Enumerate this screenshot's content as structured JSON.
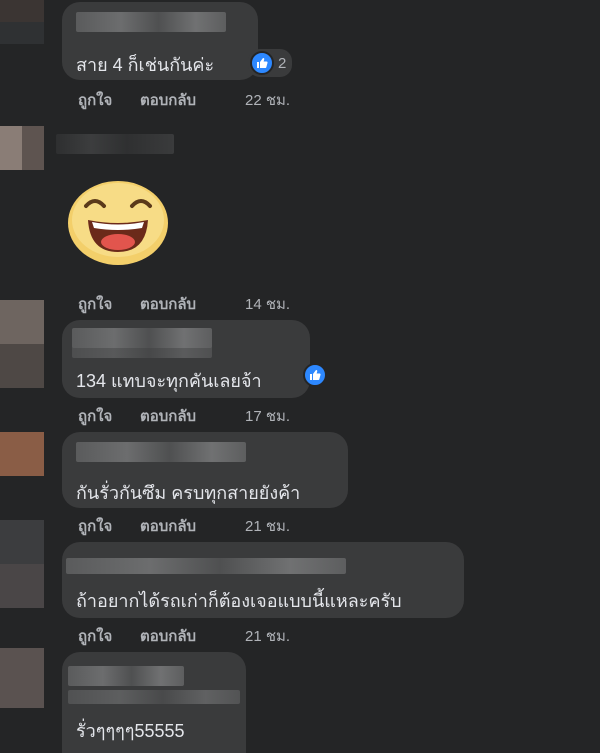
{
  "comments": [
    {
      "text": "สาย 4 ก็เช่นกันค่ะ",
      "reaction_count": "2",
      "like": "ถูกใจ",
      "reply": "ตอบกลับ",
      "time": "22 ชม."
    },
    {
      "text": "",
      "like": "ถูกใจ",
      "reply": "ตอบกลับ",
      "time": "14 ชม."
    },
    {
      "text": "134 แทบจะทุกคันเลยจ้า",
      "like": "ถูกใจ",
      "reply": "ตอบกลับ",
      "time": "17 ชม."
    },
    {
      "text": "กันรั่วกันซึม ครบทุกสายยังค้า",
      "like": "ถูกใจ",
      "reply": "ตอบกลับ",
      "time": "21 ชม."
    },
    {
      "text": "ถ้าอยากได้รถเก่าก็ต้องเจอแบบนี้แหละครับ",
      "like": "ถูกใจ",
      "reply": "ตอบกลับ",
      "time": "21 ชม."
    },
    {
      "text": "รั่วๆๆๆๆ55555"
    }
  ],
  "colors": {
    "background": "#242526",
    "bubble": "#3a3b3c",
    "like_blue": "#2d88ff",
    "emoji_yellow": "#f6d36b"
  },
  "icons": {
    "reaction": "thumbs-up-icon",
    "sticker": "laughing-face-icon"
  }
}
